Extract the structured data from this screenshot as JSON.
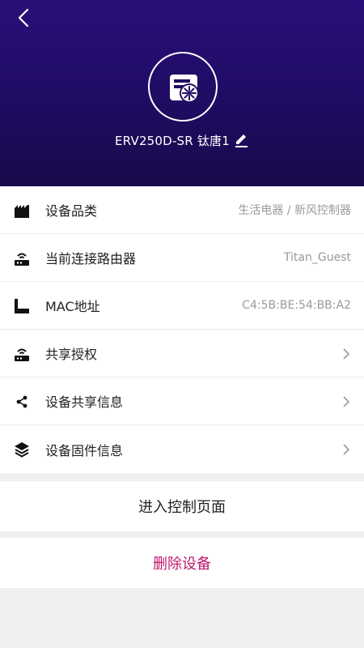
{
  "header": {
    "device_name": "ERV250D-SR 钛唐1"
  },
  "info_rows": [
    {
      "label": "设备品类",
      "value": "生活电器 / 新风控制器",
      "icon": "category-icon"
    },
    {
      "label": "当前连接路由器",
      "value": "Titan_Guest",
      "icon": "router-icon"
    },
    {
      "label": "MAC地址",
      "value": "C4:5B:BE:54:BB:A2",
      "icon": "mac-icon"
    },
    {
      "label": "共享授权",
      "value": "",
      "icon": "share-auth-icon"
    },
    {
      "label": "设备共享信息",
      "value": "",
      "icon": "share-icon"
    },
    {
      "label": "设备固件信息",
      "value": "",
      "icon": "layers-icon"
    }
  ],
  "actions": {
    "enter_control": "进入控制页面",
    "delete_device": "删除设备"
  },
  "colors": {
    "header_top": "#2a0e78",
    "header_bottom": "#170a4a",
    "delete_text": "#c0186e"
  }
}
